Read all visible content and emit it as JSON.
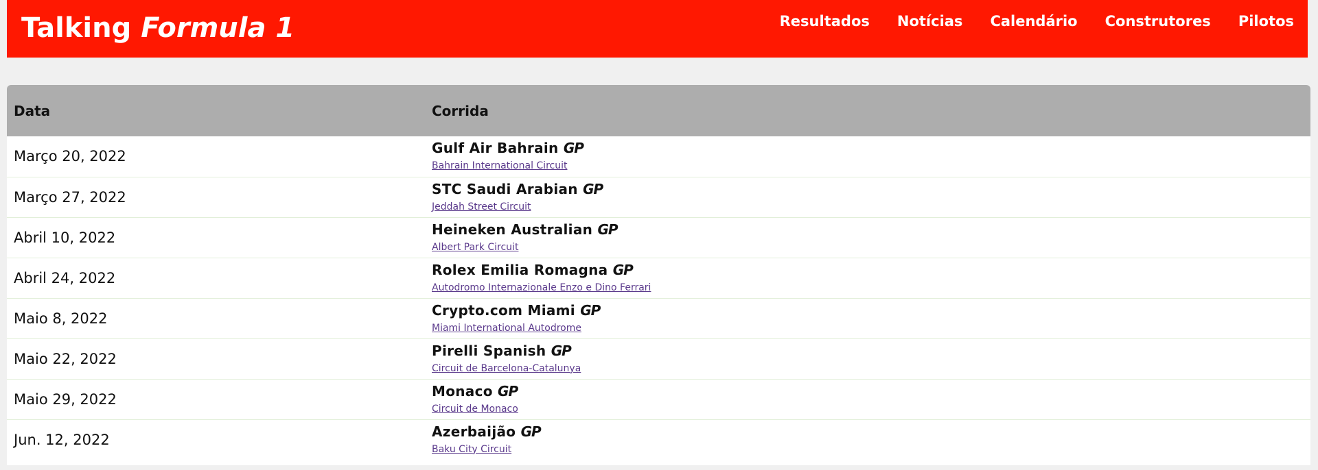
{
  "header": {
    "logo_main": "Talking",
    "logo_italic": "Formula 1",
    "nav": [
      {
        "label": "Resultados"
      },
      {
        "label": "Notícias"
      },
      {
        "label": "Calendário"
      },
      {
        "label": "Construtores"
      },
      {
        "label": "Pilotos"
      }
    ]
  },
  "table": {
    "headers": {
      "date": "Data",
      "race": "Corrida"
    },
    "rows": [
      {
        "date": "Março 20, 2022",
        "race": "Gulf Air Bahrain",
        "gp": "GP",
        "circuit": "Bahrain International Circuit"
      },
      {
        "date": "Março 27, 2022",
        "race": "STC Saudi Arabian",
        "gp": "GP",
        "circuit": "Jeddah Street Circuit"
      },
      {
        "date": "Abril 10, 2022",
        "race": "Heineken Australian",
        "gp": "GP",
        "circuit": "Albert Park Circuit"
      },
      {
        "date": "Abril 24, 2022",
        "race": "Rolex Emilia Romagna",
        "gp": "GP",
        "circuit": "Autodromo Internazionale Enzo e Dino Ferrari"
      },
      {
        "date": "Maio 8, 2022",
        "race": "Crypto.com Miami",
        "gp": "GP",
        "circuit": "Miami International Autodrome"
      },
      {
        "date": "Maio 22, 2022",
        "race": "Pirelli Spanish",
        "gp": "GP",
        "circuit": "Circuit de Barcelona-Catalunya"
      },
      {
        "date": "Maio 29, 2022",
        "race": "Monaco",
        "gp": "GP",
        "circuit": "Circuit de Monaco"
      },
      {
        "date": "Jun. 12, 2022",
        "race": "Azerbaijão",
        "gp": "GP",
        "circuit": "Baku City Circuit"
      }
    ]
  },
  "colors": {
    "header_bg": "#ff1801",
    "table_header_bg": "#adadad",
    "link": "#5b3a8c",
    "page_bg": "#f0f0f0"
  }
}
